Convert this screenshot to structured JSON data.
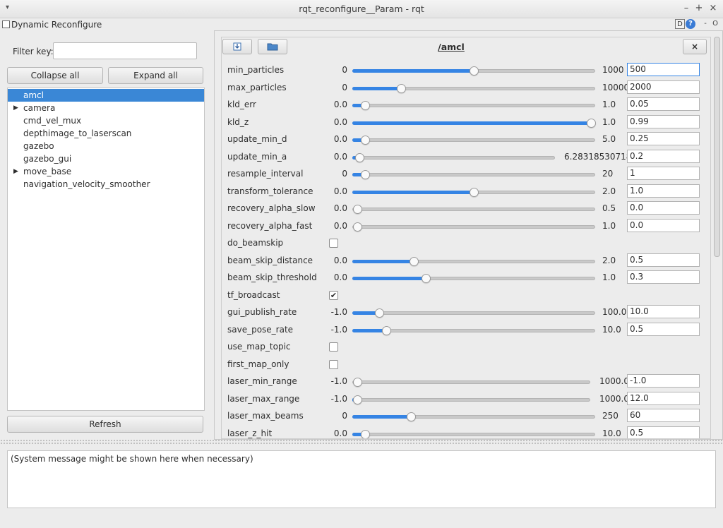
{
  "window": {
    "title": "rqt_reconfigure__Param - rqt"
  },
  "dock": {
    "title": "Dynamic Reconfigure",
    "d_label": "D",
    "help_label": "?",
    "minus_label": "-",
    "o_label": "O"
  },
  "filter": {
    "label": "Filter key:",
    "value": ""
  },
  "buttons": {
    "collapse": "Collapse all",
    "expand": "Expand all",
    "refresh": "Refresh",
    "close": "×"
  },
  "tree": {
    "items": [
      {
        "label": "amcl",
        "arrow": ""
      },
      {
        "label": "camera",
        "arrow": "▶"
      },
      {
        "label": "cmd_vel_mux",
        "arrow": ""
      },
      {
        "label": "depthimage_to_laserscan",
        "arrow": ""
      },
      {
        "label": "gazebo",
        "arrow": ""
      },
      {
        "label": "gazebo_gui",
        "arrow": ""
      },
      {
        "label": "move_base",
        "arrow": "▶"
      },
      {
        "label": "navigation_velocity_smoother",
        "arrow": ""
      }
    ]
  },
  "node": {
    "name": "/amcl"
  },
  "params": [
    {
      "name": "min_particles",
      "min": "0",
      "max": "1000",
      "value": "500",
      "level": 0.5
    },
    {
      "name": "max_particles",
      "min": "0",
      "max": "10000",
      "value": "2000",
      "level": 0.2
    },
    {
      "name": "kld_err",
      "min": "0.0",
      "max": "1.0",
      "value": "0.05",
      "level": 0.05
    },
    {
      "name": "kld_z",
      "min": "0.0",
      "max": "1.0",
      "value": "0.99",
      "level": 0.99
    },
    {
      "name": "update_min_d",
      "min": "0.0",
      "max": "5.0",
      "value": "0.25",
      "level": 0.05
    },
    {
      "name": "update_min_a",
      "min": "0.0",
      "max": "6.28318530718",
      "value": "0.2",
      "level": 0.032
    },
    {
      "name": "resample_interval",
      "min": "0",
      "max": "20",
      "value": "1",
      "level": 0.05
    },
    {
      "name": "transform_tolerance",
      "min": "0.0",
      "max": "2.0",
      "value": "1.0",
      "level": 0.5
    },
    {
      "name": "recovery_alpha_slow",
      "min": "0.0",
      "max": "0.5",
      "value": "0.0",
      "level": 0
    },
    {
      "name": "recovery_alpha_fast",
      "min": "0.0",
      "max": "1.0",
      "value": "0.0",
      "level": 0
    },
    {
      "name": "do_beamskip",
      "checked": false
    },
    {
      "name": "beam_skip_distance",
      "min": "0.0",
      "max": "2.0",
      "value": "0.5",
      "level": 0.25
    },
    {
      "name": "beam_skip_threshold",
      "min": "0.0",
      "max": "1.0",
      "value": "0.3",
      "level": 0.3
    },
    {
      "name": "tf_broadcast",
      "checked": true
    },
    {
      "name": "gui_publish_rate",
      "min": "-1.0",
      "max": "100.0",
      "value": "10.0",
      "level": 0.109
    },
    {
      "name": "save_pose_rate",
      "min": "-1.0",
      "max": "10.0",
      "value": "0.5",
      "level": 0.136
    },
    {
      "name": "use_map_topic",
      "checked": false
    },
    {
      "name": "first_map_only",
      "checked": false
    },
    {
      "name": "laser_min_range",
      "min": "-1.0",
      "max": "1000.0",
      "value": "-1.0",
      "level": 0
    },
    {
      "name": "laser_max_range",
      "min": "-1.0",
      "max": "1000.0",
      "value": "12.0",
      "level": 0.013
    },
    {
      "name": "laser_max_beams",
      "min": "0",
      "max": "250",
      "value": "60",
      "level": 0.24
    },
    {
      "name": "laser_z_hit",
      "min": "0.0",
      "max": "10.0",
      "value": "0.5",
      "level": 0.05
    }
  ],
  "icons": {
    "download": "download-icon",
    "folder": "folder-icon",
    "checkmark": "✔"
  },
  "colors": {
    "accent": "#3584e4",
    "selection": "#3a87d6"
  },
  "message": "(System message might be shown here when necessary)"
}
